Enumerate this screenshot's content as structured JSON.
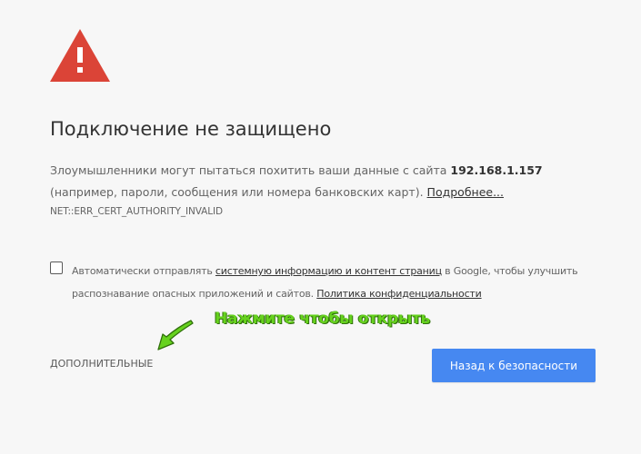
{
  "icons": {
    "warning": "warning-triangle-icon",
    "hint_arrow": "arrow-icon"
  },
  "colors": {
    "warning_red": "#db4437",
    "primary_button": "#4688f1",
    "hint_green": "#66d21e"
  },
  "heading": "Подключение не защищено",
  "explanation": {
    "text_before": "Злоумышленники могут пытаться похитить ваши данные с сайта ",
    "site": "192.168.1.157",
    "text_after": " (например, пароли, сообщения или номера банковских карт). ",
    "more_link": "Подробнее..."
  },
  "error_code": "NET::ERR_CERT_AUTHORITY_INVALID",
  "report": {
    "checked": false,
    "text_before": "Автоматически отправлять ",
    "link1": "системную информацию и контент страниц",
    "text_middle": " в Google, чтобы улучшить распознавание опасных приложений и сайтов. ",
    "link2": "Политика конфиденциальности"
  },
  "hint_text": "Нажмите чтобы открыть",
  "details_button": "ДОПОЛНИТЕЛЬНЫЕ",
  "back_button": "Назад к безопасности"
}
